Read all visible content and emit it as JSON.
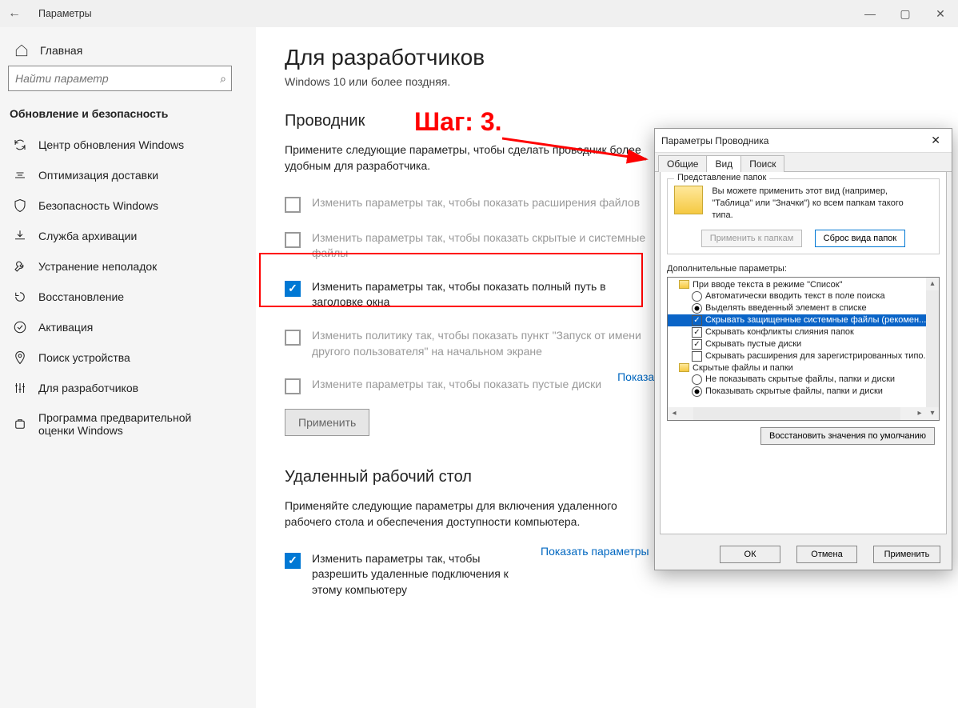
{
  "window": {
    "title": "Параметры"
  },
  "sidebar": {
    "home": "Главная",
    "search_placeholder": "Найти параметр",
    "section": "Обновление и безопасность",
    "items": [
      {
        "label": "Центр обновления Windows"
      },
      {
        "label": "Оптимизация доставки"
      },
      {
        "label": "Безопасность Windows"
      },
      {
        "label": "Служба архивации"
      },
      {
        "label": "Устранение неполадок"
      },
      {
        "label": "Восстановление"
      },
      {
        "label": "Активация"
      },
      {
        "label": "Поиск устройства"
      },
      {
        "label": "Для разработчиков"
      },
      {
        "label": "Программа предварительной оценки Windows"
      }
    ]
  },
  "main": {
    "heading": "Для разработчиков",
    "sub": "Windows 10 или более поздняя.",
    "explorer": {
      "title": "Проводник",
      "desc": "Примените следующие параметры, чтобы сделать проводник более удобным для разработчика.",
      "link": "Показать параметры",
      "opts": [
        {
          "label": "Изменить параметры так, чтобы показать расширения файлов",
          "checked": false,
          "dim": true
        },
        {
          "label": "Изменить параметры так, чтобы показать скрытые и системные файлы",
          "checked": false,
          "dim": true
        },
        {
          "label": "Изменить параметры так, чтобы показать полный путь в заголовке окна",
          "checked": true,
          "dim": false
        },
        {
          "label": "Изменить политику так, чтобы показать пункт \"Запуск от имени другого пользователя\" на начальном экране",
          "checked": false,
          "dim": true
        },
        {
          "label": "Измените параметры так, чтобы показать пустые диски",
          "checked": false,
          "dim": true
        }
      ],
      "apply": "Применить"
    },
    "remote": {
      "title": "Удаленный рабочий стол",
      "desc": "Применяйте следующие параметры для включения удаленного рабочего стола и обеспечения доступности компьютера.",
      "link": "Показать параметры",
      "opt": {
        "label": "Изменить параметры так, чтобы разрешить удаленные подключения к этому компьютеру",
        "checked": true
      }
    }
  },
  "annotation": {
    "step": "Шаг: 3."
  },
  "dialog": {
    "title": "Параметры Проводника",
    "tabs": {
      "general": "Общие",
      "view": "Вид",
      "search": "Поиск"
    },
    "folder_group": {
      "label": "Представление папок",
      "text": "Вы можете применить этот вид (например, \"Таблица\" или \"Значки\") ко всем папкам такого типа.",
      "apply": "Применить к папкам",
      "reset": "Сброс вида папок"
    },
    "extra_label": "Дополнительные параметры:",
    "tree": [
      {
        "type": "folder",
        "label": "При вводе текста в режиме \"Список\""
      },
      {
        "type": "radio",
        "checked": false,
        "label": "Автоматически вводить текст в поле поиска"
      },
      {
        "type": "radio",
        "checked": true,
        "label": "Выделять введенный элемент в списке"
      },
      {
        "type": "check",
        "checked": true,
        "hl": true,
        "label": "Скрывать защищенные системные файлы (рекомен..."
      },
      {
        "type": "check",
        "checked": true,
        "label": "Скрывать конфликты слияния папок"
      },
      {
        "type": "check",
        "checked": true,
        "label": "Скрывать пустые диски"
      },
      {
        "type": "check",
        "checked": false,
        "label": "Скрывать расширения для зарегистрированных типо..."
      },
      {
        "type": "folder",
        "label": "Скрытые файлы и папки"
      },
      {
        "type": "radio",
        "checked": false,
        "label": "Не показывать скрытые файлы, папки и диски"
      },
      {
        "type": "radio",
        "checked": true,
        "label": "Показывать скрытые файлы, папки и диски"
      }
    ],
    "restore": "Восстановить значения по умолчанию",
    "ok": "ОК",
    "cancel": "Отмена",
    "apply": "Применить"
  }
}
